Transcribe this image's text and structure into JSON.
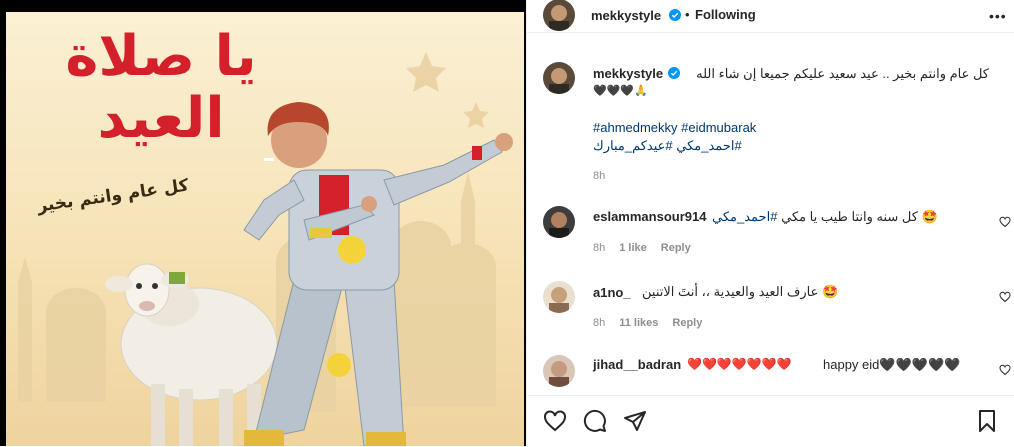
{
  "post": {
    "image": {
      "title_line1": "يا صلاة",
      "title_line2": "العيد",
      "greeting": "كل عام وانتم بخير"
    },
    "header": {
      "username": "mekkystyle",
      "separator": "•",
      "follow_status": "Following",
      "more": "•••"
    },
    "caption": {
      "username": "mekkystyle",
      "line1": "كل عام وانتم بخير .. عيد سعيد عليكم جميعا إن شاء الله",
      "line2": "🖤🖤🖤🙏",
      "hashtags_line1": "#ahmedmekky #eidmubarak",
      "hashtags_line2": "#احمد_مكي #عيدكم_مبارك",
      "time": "8h"
    },
    "comments": [
      {
        "username": "eslammansour914",
        "text": "كل سنه وانتا طيب يا مكي",
        "mention": "#احمد_مكي",
        "emoji": "🤩",
        "time": "8h",
        "likes": "1 like",
        "reply": "Reply"
      },
      {
        "username": "a1no_",
        "text": "عارف العيد والعيدية ،، أنتَ الاتنين",
        "emoji": "🤩",
        "time": "8h",
        "likes": "11 likes",
        "reply": "Reply"
      },
      {
        "username": "jihad__badran",
        "text": "happy eid🖤🖤🖤🖤🖤",
        "hearts": "❤️❤️❤️❤️❤️❤️❤️"
      }
    ],
    "colors": {
      "link": "#00376b",
      "verified": "#0095f6",
      "muted": "#8e8e8e",
      "text": "#262626",
      "poster_red": "#d4202a"
    }
  }
}
